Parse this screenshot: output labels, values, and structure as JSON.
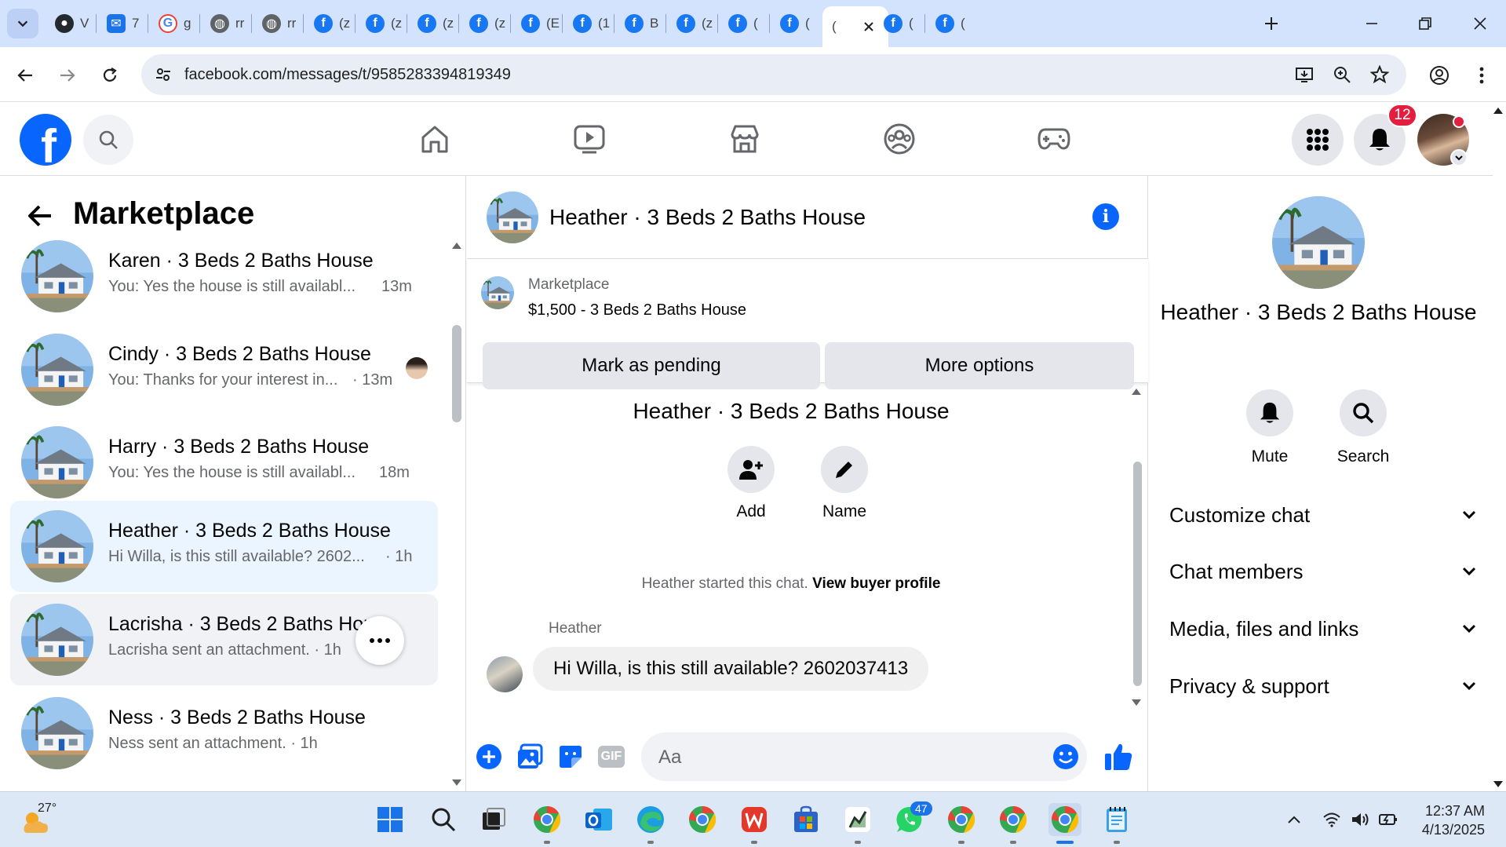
{
  "browser": {
    "tabs": [
      {
        "icon": "github-icon",
        "text": "V"
      },
      {
        "icon": "gmail-icon",
        "text": "7"
      },
      {
        "icon": "google-icon",
        "text": "g"
      },
      {
        "icon": "globe-icon",
        "text": "rr"
      },
      {
        "icon": "globe-icon",
        "text": "rr"
      },
      {
        "icon": "facebook-icon",
        "text": "(z"
      },
      {
        "icon": "facebook-icon",
        "text": "(z"
      },
      {
        "icon": "facebook-icon",
        "text": "(z"
      },
      {
        "icon": "facebook-icon",
        "text": "(z"
      },
      {
        "icon": "facebook-icon",
        "text": "(E"
      },
      {
        "icon": "facebook-icon",
        "text": "(1"
      },
      {
        "icon": "facebook-icon",
        "text": "B"
      },
      {
        "icon": "facebook-icon",
        "text": "(z"
      },
      {
        "icon": "facebook-icon",
        "text": "("
      },
      {
        "icon": "facebook-icon",
        "text": "("
      },
      {
        "icon": "facebook-icon",
        "text": "(",
        "active": true
      },
      {
        "icon": "facebook-icon",
        "text": "("
      },
      {
        "icon": "facebook-icon",
        "text": "("
      }
    ],
    "url": "facebook.com/messages/t/9585283394819349"
  },
  "fb_nav": {
    "notification_count": "12"
  },
  "left_panel": {
    "title": "Marketplace",
    "conversations": [
      {
        "title": "Karen · 3 Beds 2 Baths House",
        "snippet": "You: Yes the house is still availabl...",
        "time": "13m"
      },
      {
        "title": "Cindy · 3 Beds 2 Baths House",
        "snippet": "You: Thanks for your interest in...",
        "time": "· 13m"
      },
      {
        "title": "Harry · 3 Beds 2 Baths House",
        "snippet": "You: Yes the house is still availabl...",
        "time": "18m"
      },
      {
        "title": "Heather · 3 Beds 2 Baths House",
        "snippet": "Hi Willa, is this still available? 2602...",
        "time": "· 1h"
      },
      {
        "title": "Lacrisha · 3 Beds 2 Baths Hou",
        "snippet": "Lacrisha sent an attachment. · 1h",
        "time": ""
      },
      {
        "title": "Ness · 3 Beds 2 Baths House",
        "snippet": "Ness sent an attachment. · 1h",
        "time": ""
      }
    ]
  },
  "chat": {
    "header_title": "Heather · 3 Beds 2 Baths House",
    "marketplace_label": "Marketplace",
    "listing": "$1,500 - 3 Beds 2 Baths House",
    "mark_pending_label": "Mark as pending",
    "more_options_label": "More options",
    "group_name": "Heather · 3 Beds 2 Baths House",
    "add_label": "Add",
    "name_label": "Name",
    "started_text": "Heather started this chat.",
    "view_profile_label": "View buyer profile",
    "sender_name": "Heather",
    "message": "Hi Willa, is this still available? 2602037413",
    "composer_placeholder": "Aa",
    "gif_label": "GIF"
  },
  "info_panel": {
    "name": "Heather · 3 Beds 2 Baths House",
    "mute_label": "Mute",
    "search_label": "Search",
    "sections": [
      "Customize chat",
      "Chat members",
      "Media, files and links",
      "Privacy & support"
    ]
  },
  "taskbar": {
    "temperature": "27°",
    "whatsapp_badge": "47",
    "time": "12:37 AM",
    "date": "4/13/2025"
  },
  "colors": {
    "fb_blue": "#0866ff",
    "selected_row": "#ebf5ff",
    "tab_strip": "#d3e3fd"
  }
}
